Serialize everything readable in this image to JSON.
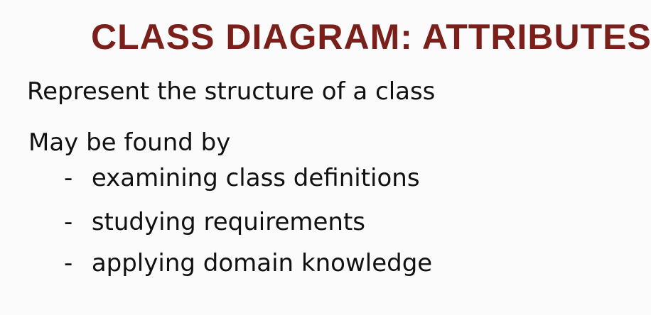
{
  "slide": {
    "title": "CLASS DIAGRAM: ATTRIBUTES",
    "title_color": "#7a1f1a",
    "text_color": "#111111",
    "background": "#fbfbfb",
    "intro": "Represent the structure of a class",
    "subheading": "May be found by",
    "bullet_marker": "-",
    "bullets": [
      {
        "text": "examining class definitions"
      },
      {
        "text": "studying requirements"
      },
      {
        "text": "applying domain knowledge"
      }
    ]
  }
}
